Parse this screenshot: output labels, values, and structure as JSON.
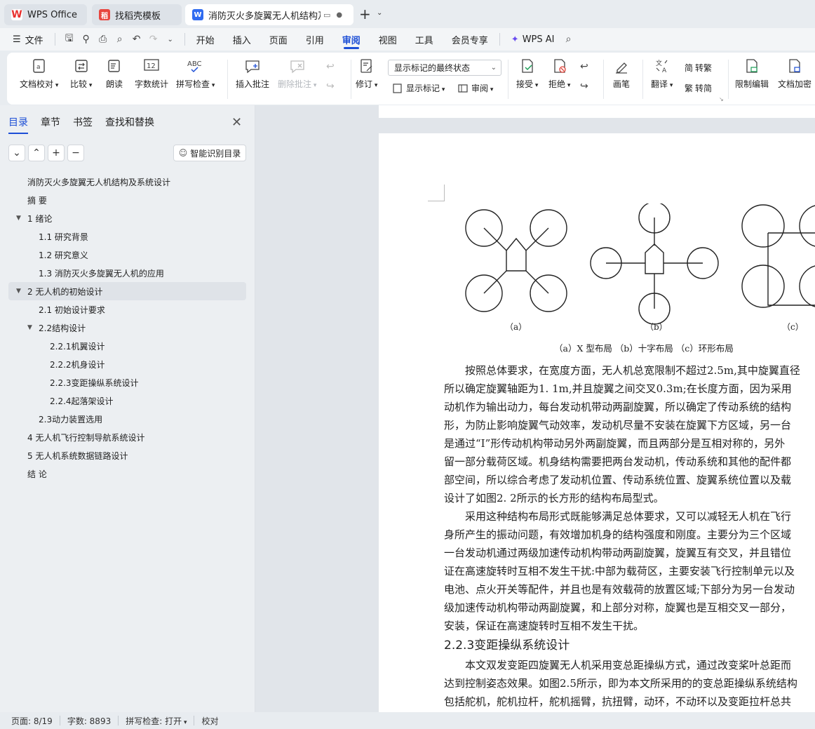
{
  "tabs": [
    {
      "label": "WPS Office",
      "icon": "wps-logo-icon"
    },
    {
      "label": "找稻壳模板",
      "icon": "docer-icon"
    },
    {
      "label": "消防灭火多旋翼无人机结构及系",
      "icon": "word-doc-icon"
    }
  ],
  "menu": {
    "file": "文件",
    "tabs": [
      "开始",
      "插入",
      "页面",
      "引用",
      "审阅",
      "视图",
      "工具",
      "会员专享"
    ],
    "active_tab": "审阅",
    "wps_ai": "WPS AI"
  },
  "ribbon": {
    "doc_proof": "文档校对",
    "compare": "比较",
    "read_aloud": "朗读",
    "word_count": "字数统计",
    "spell_check": "拼写检查",
    "insert_comment": "插入批注",
    "delete_comment": "删除批注",
    "revise": "修订",
    "markup_select": "显示标记的最终状态",
    "show_markup": "显示标记",
    "review_pane": "审阅",
    "accept": "接受",
    "reject": "拒绝",
    "ink": "画笔",
    "translate": "翻译",
    "to_traditional": "转繁",
    "to_simplified": "转简",
    "restrict_edit": "限制编辑",
    "encrypt": "文档加密",
    "abc": "ABC",
    "count_12": "12"
  },
  "sidebar": {
    "tabs": [
      "目录",
      "章节",
      "书签",
      "查找和替换"
    ],
    "active_tab": "目录",
    "smart_toc": "智能识别目录",
    "toc": [
      {
        "label": "消防灭火多旋翼无人机结构及系统设计",
        "level": 1,
        "expanded": null,
        "selected": false
      },
      {
        "label": "摘 要",
        "level": 1,
        "expanded": null,
        "selected": false
      },
      {
        "label": "1 绪论",
        "level": 1,
        "expanded": true,
        "selected": false
      },
      {
        "label": "1.1 研究背景",
        "level": 2,
        "expanded": null,
        "selected": false
      },
      {
        "label": "1.2 研究意义",
        "level": 2,
        "expanded": null,
        "selected": false
      },
      {
        "label": "1.3 消防灭火多旋翼无人机的应用",
        "level": 2,
        "expanded": null,
        "selected": false
      },
      {
        "label": "2 无人机的初始设计",
        "level": 1,
        "expanded": true,
        "selected": true
      },
      {
        "label": "2.1 初始设计要求",
        "level": 2,
        "expanded": null,
        "selected": false
      },
      {
        "label": "2.2结构设计",
        "level": 2,
        "expanded": true,
        "selected": false
      },
      {
        "label": "2.2.1机翼设计",
        "level": 3,
        "expanded": null,
        "selected": false
      },
      {
        "label": "2.2.2机身设计",
        "level": 3,
        "expanded": null,
        "selected": false
      },
      {
        "label": "2.2.3变距操纵系统设计",
        "level": 3,
        "expanded": null,
        "selected": false
      },
      {
        "label": "2.2.4起落架设计",
        "level": 3,
        "expanded": null,
        "selected": false
      },
      {
        "label": "2.3动力装置选用",
        "level": 2,
        "expanded": null,
        "selected": false
      },
      {
        "label": "4 无人机飞行控制导航系统设计",
        "level": 1,
        "expanded": null,
        "selected": false
      },
      {
        "label": "5 无人机系统数据链路设计",
        "level": 1,
        "expanded": null,
        "selected": false
      },
      {
        "label": "结 论",
        "level": 1,
        "expanded": null,
        "selected": false
      }
    ]
  },
  "document": {
    "figure_labels": [
      "（a）",
      "（b）",
      "（c）"
    ],
    "figure_caption": "（a）X 型布局 （b）十字布局 （c）环形布局",
    "paragraphs": [
      "按照总体要求，在宽度方面，无人机总宽限制不超过2.5m,其中旋翼直径",
      "所以确定旋翼轴距为1.  1m,并且旋翼之间交叉0.3m;在长度方面，因为采用",
      "动机作为输出动力，每台发动机带动两副旋翼，所以确定了传动系统的结构",
      "形，为防止影响旋翼气动效率，发动机尽量不安装在旋翼下方区域，另一台",
      "是通过“I”形传动机构带动另外两副旋翼，而且两部分是互相对称的，另外",
      "留一部分载荷区域。机身结构需要把两台发动机，传动系统和其他的配件都",
      "部空间，所以综合考虑了发动机位置、传动系统位置、旋翼系统位置以及载",
      "设计了如图2.  2所示的长方形的结构布局型式。",
      "采用这种结构布局形式既能够满足总体要求，又可以减轻无人机在飞行",
      "身所产生的振动问题，有效增加机身的结构强度和刚度。主要分为三个区域",
      "一台发动机通过两级加速传动机构带动两副旋翼，旋翼互有交叉，并且错位",
      "证在高速旋转时互相不发生干扰:中部为载荷区，主要安装飞行控制单元以及",
      "电池、点火开关等配件，并且也是有效载荷的放置区域;下部分为另一台发动",
      "级加速传动机构带动两副旋翼，和上部分对称，旋翼也是互相交叉一部分，",
      "安装，保证在高速旋转时互相不发生干扰。"
    ],
    "heading": "2.2.3变距操纵系统设计",
    "paragraphs2": [
      "本文双发变距四旋翼无人机采用变总距操纵方式，通过改变桨叶总距而",
      "达到控制姿态效果。如图2.5所示，即为本文所采用的的变总距操纵系统结构",
      "包括舵机，舵机拉杆，舵机摇臂，抗扭臂，动环，不动环以及变距拉杆总共"
    ]
  },
  "status": {
    "page": "页面: 8/19",
    "words": "字数: 8893",
    "spell": "拼写检查: 打开",
    "proof": "校对"
  },
  "colors": {
    "accent": "#1d4fd6",
    "wps_red": "#e8312f"
  }
}
